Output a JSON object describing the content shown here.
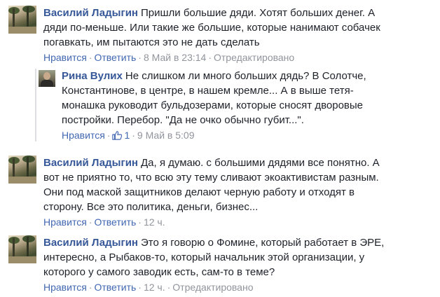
{
  "comments": [
    {
      "author": "Василий Ладыгин",
      "text": "Пришли большие дяди. Хотят больших денег. А дяди по-меньше. Или такие же большие, которые нанимают собачек погавкать, им пытаются это не дать сделать",
      "like_label": "Нравится",
      "reply_label": "Ответить",
      "time": "8 Май в 23:14",
      "edited": "Отредактировано",
      "replies": [
        {
          "author": "Рина Вулих",
          "text": "Не слишком ли много больших дядь? В Солотче, Константинове, в центре, в нашем кремле... А в выше тетя-монашка руководит бульдозерами, которые сносят дворовые постройки. Перебор. \"Да не очко обычно губит...\".",
          "like_label": "Нравится",
          "likes": "1",
          "time": "9 Май в 5:09"
        }
      ]
    },
    {
      "author": "Василий Ладыгин",
      "text": "Да, я думаю. с большими дядями все понятно. А вот не приятно то, что всю эту тему сливают экоактивистам разным. Они под маской защитников делают черную работу и отходят в сторону. Все это политика, деньги, бизнес...",
      "like_label": "Нравится",
      "reply_label": "Ответить",
      "time": "12 ч."
    },
    {
      "author": "Василий Ладыгин",
      "text": "Это я говорю о Фомине, который работает в ЭРЕ, интересно, а Рыбаков-то, который начальник этой организации, у которого у самого заводик есть, сам-то в теме?",
      "like_label": "Нравится",
      "reply_label": "Ответить",
      "time": "12 ч.",
      "edited": "Отредактировано"
    }
  ],
  "colors": {
    "link": "#365899",
    "meta": "#90949c",
    "action": "#4267b2"
  },
  "icons": {
    "like": "thumbs-up-icon"
  }
}
